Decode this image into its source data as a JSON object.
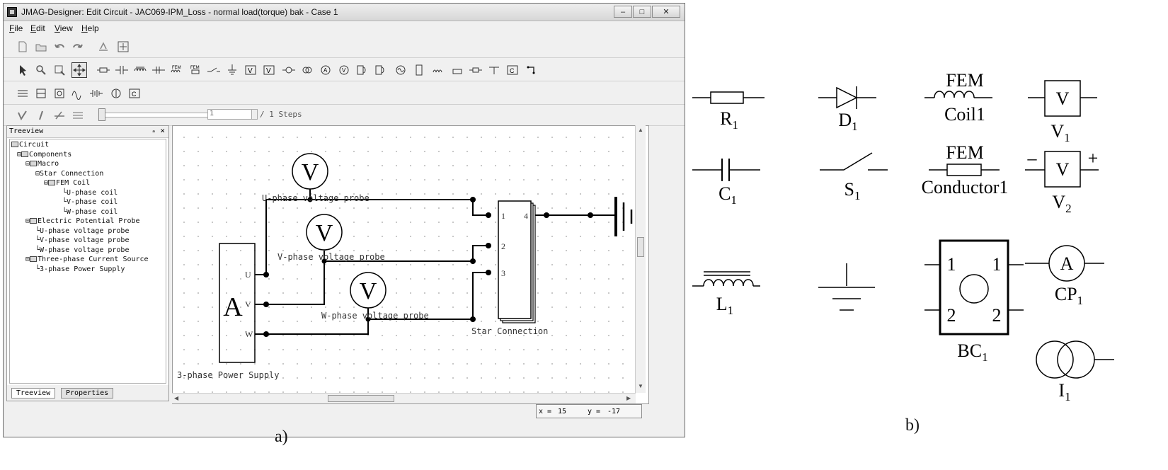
{
  "window": {
    "title": "JMAG-Designer: Edit Circuit - JAC069-IPM_Loss - normal load(torque) bak - Case 1",
    "buttons": {
      "minimize": "–",
      "maximize": "□",
      "close": "✕"
    }
  },
  "menu": [
    "File",
    "Edit",
    "View",
    "Help"
  ],
  "toolbar": {
    "steps_value": "1",
    "steps_label": "/ 1 Steps"
  },
  "treeview": {
    "title": "Treeview",
    "pin": "ₐ",
    "close": "×",
    "nodes": [
      "Circuit",
      "Components",
      "Macro",
      "Star Connection",
      "FEM Coil",
      "U-phase coil",
      "V-phase coil",
      "W-phase coil",
      "Electric Potential  Probe",
      "U-phase voltage probe",
      "V-phase voltage probe",
      "W-phase voltage probe",
      "Three-phase Current Source",
      "3-phase Power Supply"
    ],
    "tabs": [
      "Treeview",
      "Properties"
    ]
  },
  "circuit": {
    "probe_symbol": "V",
    "source_symbol": "A",
    "probes": [
      "U-phase voltage probe",
      "V-phase voltage probe",
      "W-phase voltage probe"
    ],
    "source_label": "3-phase Power Supply",
    "source_ports": [
      "U",
      "V",
      "W"
    ],
    "star_label": "Star Connection",
    "star_ports": [
      "1",
      "2",
      "3",
      "4"
    ]
  },
  "status": {
    "x_label": "x =",
    "x_value": "15",
    "y_label": "y =",
    "y_value": "-17"
  },
  "captions": {
    "a": "a)",
    "b": "b)"
  },
  "symbols": {
    "resistor": {
      "name": "R",
      "sub": "1"
    },
    "diode": {
      "name": "D",
      "sub": "1"
    },
    "fem_coil": {
      "top": "FEM",
      "bottom": "Coil1"
    },
    "voltmeter": {
      "glyph": "V",
      "name": "V",
      "sub": "1"
    },
    "capacitor": {
      "name": "C",
      "sub": "1"
    },
    "switch": {
      "name": "S",
      "sub": "1"
    },
    "fem_conductor": {
      "top": "FEM",
      "bottom": "Conductor1"
    },
    "voltage_probe": {
      "glyph": "V",
      "minus": "–",
      "plus": "+",
      "name": "V",
      "sub": "2"
    },
    "inductor": {
      "name": "L",
      "sub": "1"
    },
    "bc": {
      "name": "BC",
      "sub": "1",
      "pins": [
        "1",
        "1",
        "2",
        "2"
      ]
    },
    "current_probe": {
      "glyph": "A",
      "name": "CP",
      "sub": "1"
    },
    "current_source": {
      "name": "I",
      "sub": "1"
    }
  }
}
